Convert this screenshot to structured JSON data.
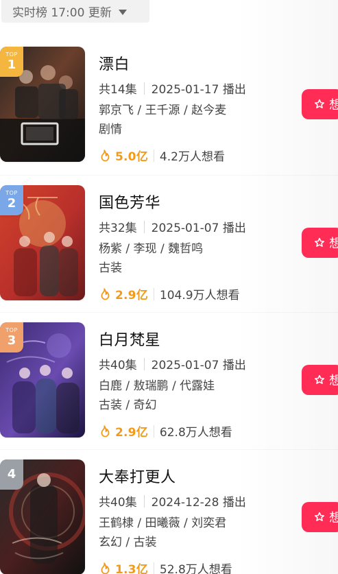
{
  "header": {
    "realtime_label": "实时榜 17:00 更新"
  },
  "list": {
    "items": [
      {
        "rank": "1",
        "top_label": "TOP",
        "title": "漂白",
        "episodes": "共14集",
        "date_status": "2025-01-17 播出",
        "cast": "郭京飞 / 王千源 / 赵今麦",
        "genre": "剧情",
        "heat": "5.0亿",
        "want": "4.2万人想看",
        "button_label": "想"
      },
      {
        "rank": "2",
        "top_label": "TOP",
        "title": "国色芳华",
        "episodes": "共32集",
        "date_status": "2025-01-07 播出",
        "cast": "杨紫 / 李现 / 魏哲鸣",
        "genre": "古装",
        "heat": "2.9亿",
        "want": "104.9万人想看",
        "button_label": "想"
      },
      {
        "rank": "3",
        "top_label": "TOP",
        "title": "白月梵星",
        "episodes": "共40集",
        "date_status": "2025-01-07 播出",
        "cast": "白鹿 / 敖瑞鹏 / 代露娃",
        "genre": "古装 / 奇幻",
        "heat": "2.9亿",
        "want": "62.8万人想看",
        "button_label": "想"
      },
      {
        "rank": "4",
        "top_label": "",
        "title": "大奉打更人",
        "episodes": "共40集",
        "date_status": "2024-12-28 播出",
        "cast": "王鹤棣 / 田曦薇 / 刘奕君",
        "genre": "玄幻 / 古装",
        "heat": "1.3亿",
        "want": "52.8万人想看",
        "button_label": "想"
      }
    ]
  },
  "colors": {
    "accent": "#ff2d55",
    "heat": "#f29b1a",
    "rank1": "#f5b640",
    "rank2": "#7aa7e8",
    "rank3": "#f0a06a",
    "rank4": "#9aa0a6"
  },
  "icons": {
    "dropdown": "caret-down-icon",
    "heat": "flame-icon",
    "want": "star-outline-icon"
  }
}
